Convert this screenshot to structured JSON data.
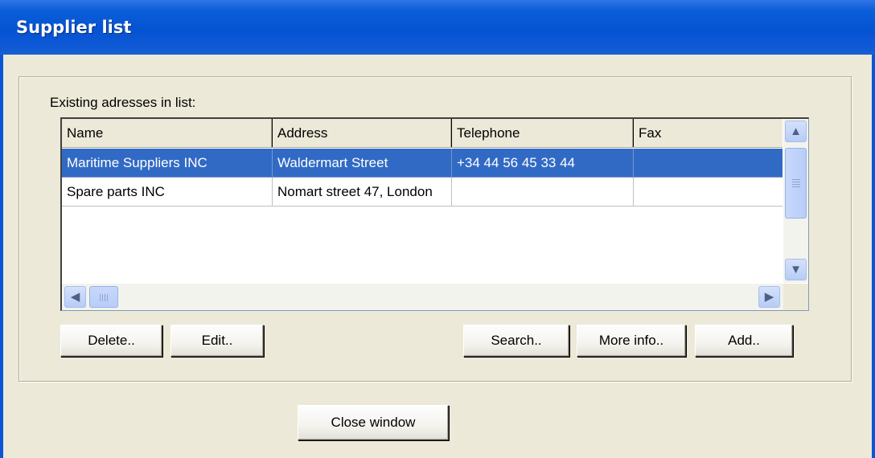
{
  "window": {
    "title": "Supplier list"
  },
  "group": {
    "caption": "Existing adresses in list:"
  },
  "list": {
    "columns": [
      "Name",
      "Address",
      "Telephone",
      "Fax"
    ],
    "rows": [
      [
        "Maritime Suppliers INC",
        "Waldermart Street",
        "+34 44 56 45 33 44",
        ""
      ],
      [
        "Spare parts INC",
        "Nomart street 47, London",
        "",
        ""
      ]
    ],
    "selected_row": 0
  },
  "buttons": {
    "delete": "Delete..",
    "edit": "Edit..",
    "search": "Search..",
    "more_info": "More info..",
    "add": "Add..",
    "close": "Close window"
  },
  "icons": {
    "scroll_up": "chevron-up-icon",
    "scroll_down": "chevron-down-icon",
    "scroll_left": "chevron-left-icon",
    "scroll_right": "chevron-right-icon"
  },
  "colors": {
    "titlebar": "#0453d3",
    "selection": "#316ac5",
    "dialog_bg": "#ece9d8"
  }
}
